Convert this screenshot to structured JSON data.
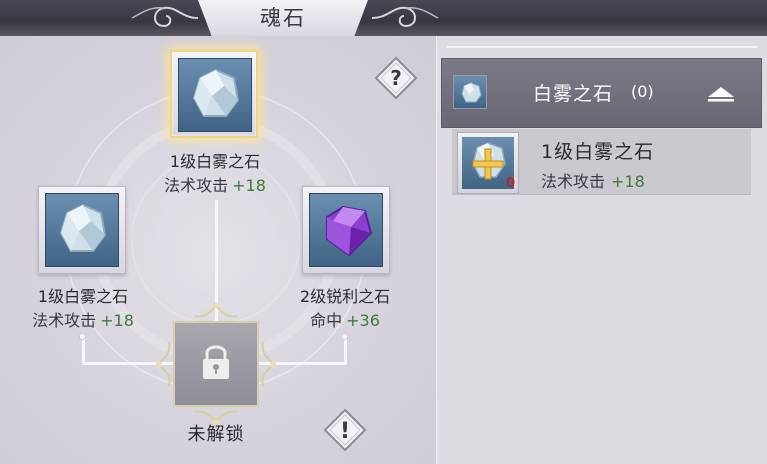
{
  "header": {
    "title": "魂石"
  },
  "slots": {
    "top": {
      "name": "1级白雾之石",
      "stat": "法术攻击",
      "bonus": "+18",
      "gem": "white-mist-gem-icon"
    },
    "left": {
      "name": "1级白雾之石",
      "stat": "法术攻击",
      "bonus": "+18",
      "gem": "white-mist-gem-icon"
    },
    "right": {
      "name": "2级锐利之石",
      "stat": "命中",
      "bonus": "+36",
      "gem": "sharp-stone-gem-icon"
    },
    "locked": {
      "label": "未解锁",
      "icon": "lock-icon"
    }
  },
  "buttons": {
    "help": {
      "glyph": "?",
      "icon": "question-icon"
    },
    "info": {
      "glyph": "!",
      "icon": "exclamation-icon"
    }
  },
  "list": {
    "category": {
      "label": "白雾之石",
      "count": "(0)",
      "icon": "white-mist-gem-icon",
      "toggle": "collapse-arrow-icon"
    },
    "items": [
      {
        "name": "1级白雾之石",
        "stat": "法术攻击",
        "bonus": "+18",
        "count": "0",
        "icon": "white-mist-gem-plus-icon"
      }
    ]
  },
  "colors": {
    "bonus_green": "#3e7a3a",
    "selected_glow": "#f0d488",
    "count_red": "#b02a2a",
    "category_bg": "#7d7a88"
  }
}
